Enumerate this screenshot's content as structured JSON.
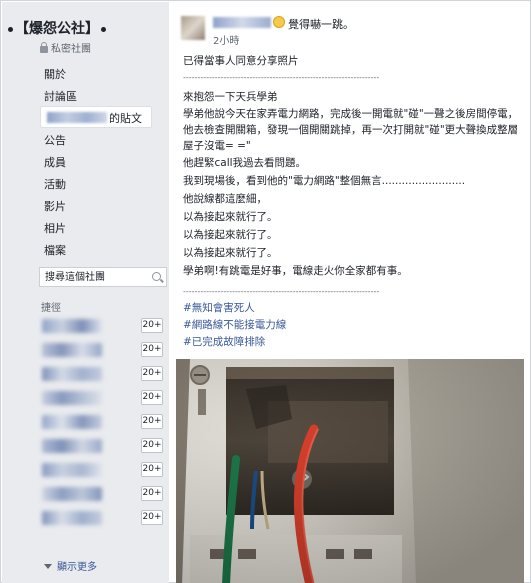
{
  "sidebar": {
    "group_name": "【爆怨公社】",
    "group_type": "私密社團",
    "nav_items": [
      "關於",
      "討論區",
      "公告",
      "成員",
      "活動",
      "影片",
      "相片",
      "檔案"
    ],
    "selected_suffix": "的貼文",
    "search_placeholder": "搜尋這個社團",
    "shortcuts_heading": "捷徑",
    "shortcut_badges": [
      "20+",
      "20+",
      "20+",
      "20+",
      "20+",
      "20+",
      "20+",
      "20+",
      "20+"
    ],
    "show_more": "顯示更多"
  },
  "post": {
    "feeling": "覺得嚇一跳。",
    "time": "2小時",
    "body_lines": [
      "已得當事人同意分享照片",
      "--------------------------------------------------------------------",
      "來抱怨一下天兵學弟",
      "學弟他說今天在家弄電力網路，完成後一開電就\"碰\"一聲之後房間停電，",
      "他去檢查開關箱，發現一個開關跳掉，再一次打開就\"碰\"更大聲換成整層",
      "屋子沒電= =\"",
      "他趕緊call我過去看問題。",
      "我到現場後，看到他的\"電力網路\"整個無言.........................",
      "他說線都這麼細，",
      "以為接起來就行了。",
      "以為接起來就行了。",
      "以為接起來就行了。",
      "學弟啊!有跳電是好事，電線走火你全家都有事。",
      "--------------------------------------------------------------------",
      "#無知會害死人",
      "#網路線不能接電力線",
      "#已完成故障排除"
    ]
  },
  "colors": {
    "sidebar_bg": "#e9ebee",
    "link": "#385898",
    "text": "#1d2129",
    "muted": "#606770"
  }
}
